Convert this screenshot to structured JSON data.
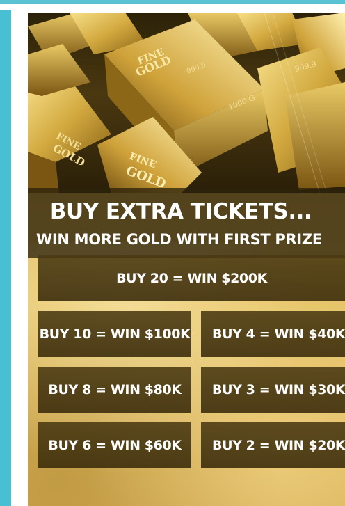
{
  "headline": {
    "title": "BUY EXTRA TICKETS...",
    "subtitle": "WIN MORE GOLD WITH FIRST PRIZE"
  },
  "offers": {
    "featured": "BUY 20 = WIN $200K",
    "items": [
      "BUY 10 = WIN $100K",
      "BUY 4 = WIN $40K",
      "BUY 8 = WIN $80K",
      "BUY 3 = WIN $30K",
      "BUY 6 = WIN $60K",
      "BUY 2 = WIN $20K"
    ]
  },
  "colors": {
    "accent_teal": "#48bfd2",
    "gold": "#d9b457",
    "tile_dark": "#4a3912"
  }
}
